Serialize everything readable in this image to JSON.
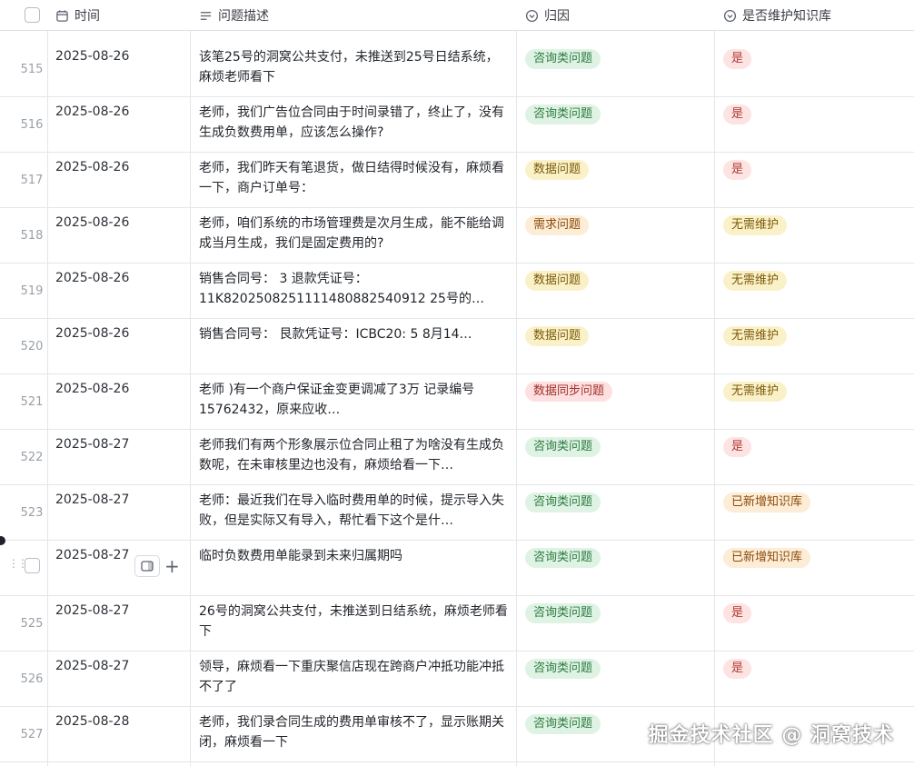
{
  "columns": {
    "time": "时间",
    "description": "问题描述",
    "category": "归因",
    "knowledge": "是否维护知识库"
  },
  "tag_styles": {
    "咨询类问题": {
      "bg": "#dff3e4",
      "fg": "#2c7a3f"
    },
    "数据问题": {
      "bg": "#fbf1c8",
      "fg": "#7a5a0a"
    },
    "需求问题": {
      "bg": "#fdecd6",
      "fg": "#8a4b0b"
    },
    "数据同步问题": {
      "bg": "#fde0df",
      "fg": "#a1302b"
    },
    "是": {
      "bg": "#fde4e2",
      "fg": "#b13a33"
    },
    "无需维护": {
      "bg": "#fbf1c8",
      "fg": "#7a5a0a"
    },
    "已新增知识库": {
      "bg": "#fdecd6",
      "fg": "#8a4b0b"
    }
  },
  "rows": [
    {
      "num": "515",
      "date": "2025-08-26",
      "desc": "该笔25号的洞窝公共支付，未推送到25号日结系统，麻烦老师看下",
      "category": "咨询类问题",
      "knowledge": "是"
    },
    {
      "num": "516",
      "date": "2025-08-26",
      "desc": "老师，我们广告位合同由于时间录错了，终止了，没有生成负数费用单，应该怎么操作?",
      "category": "咨询类问题",
      "knowledge": "是"
    },
    {
      "num": "517",
      "date": "2025-08-26",
      "desc": "老师，我们昨天有笔退货，做日结得时候没有，麻烦看一下，商户订单号：",
      "category": "数据问题",
      "knowledge": "是"
    },
    {
      "num": "518",
      "date": "2025-08-26",
      "desc": "老师，咱们系统的市场管理费是次月生成，能不能给调成当月生成，我们是固定费用的?",
      "category": "需求问题",
      "knowledge": "无需维护"
    },
    {
      "num": "519",
      "date": "2025-08-26",
      "desc": "销售合同号：                                  3 退款凭证号：11K8202508251111480882540912 25号的…",
      "category": "数据问题",
      "knowledge": "无需维护"
    },
    {
      "num": "520",
      "date": "2025-08-26",
      "desc": "销售合同号：                                   艮款凭证号：ICBC20:                          5 8月14…",
      "category": "数据问题",
      "knowledge": "无需维护"
    },
    {
      "num": "521",
      "date": "2025-08-26",
      "desc": "老师                )有一个商户保证金变更调减了3万 记录编号                15762432，原来应收…",
      "category": "数据同步问题",
      "knowledge": "无需维护"
    },
    {
      "num": "522",
      "date": "2025-08-27",
      "desc": "老师我们有两个形象展示位合同止租了为啥没有生成负数呢，在未审核里边也没有，麻烦给看一下…",
      "category": "咨询类问题",
      "knowledge": "是"
    },
    {
      "num": "523",
      "date": "2025-08-27",
      "desc": "老师：最近我们在导入临时费用单的时候，提示导入失败，但是实际又有导入，帮忙看下这个是什…",
      "category": "咨询类问题",
      "knowledge": "已新增知识库"
    },
    {
      "num": "",
      "date": "2025-08-27",
      "desc": "临时负数费用单能录到未来归属期吗",
      "category": "咨询类问题",
      "knowledge": "已新增知识库"
    },
    {
      "num": "525",
      "date": "2025-08-27",
      "desc": "26号的洞窝公共支付，未推送到日结系统，麻烦老师看下",
      "category": "咨询类问题",
      "knowledge": "是"
    },
    {
      "num": "526",
      "date": "2025-08-27",
      "desc": "领导，麻烦看一下重庆聚信店现在跨商户冲抵功能冲抵不了了",
      "category": "咨询类问题",
      "knowledge": "是"
    },
    {
      "num": "527",
      "date": "2025-08-28",
      "desc": "老师，我们录合同生成的费用单审核不了，显示账期关闭，麻烦看一下",
      "category": "咨询类问题",
      "knowledge": ""
    }
  ],
  "watermark": "掘金技术社区 @ 洞窝技术"
}
